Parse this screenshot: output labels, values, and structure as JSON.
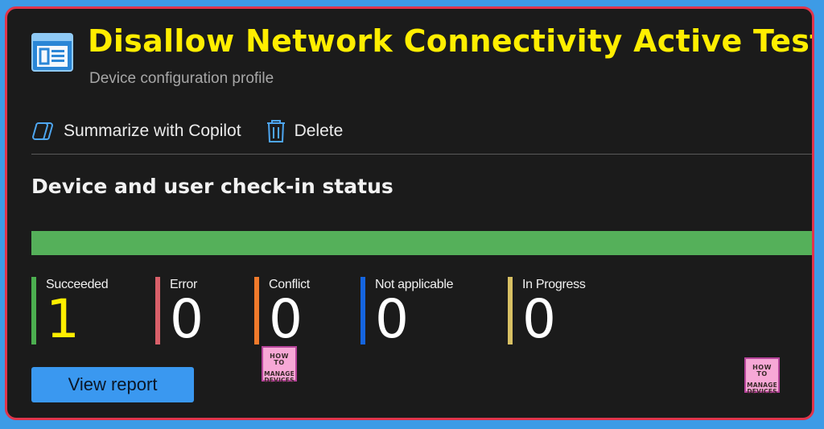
{
  "header": {
    "title": "Disallow Network Connectivity Active Tests",
    "subtitle": "Device configuration profile",
    "icon": "profile-icon"
  },
  "toolbar": {
    "summarize_label": "Summarize with Copilot",
    "delete_label": "Delete",
    "icons": [
      "copilot-icon",
      "trash-icon"
    ]
  },
  "status": {
    "title": "Device and user check-in status",
    "progress": {
      "succeeded_fraction": 1.0,
      "fill_color": "#55b05a"
    },
    "stats": [
      {
        "label": "Succeeded",
        "value": "1",
        "color": "#4caf50",
        "value_color": "#ffee00"
      },
      {
        "label": "Error",
        "value": "0",
        "color": "#d9606a",
        "value_color": "#ffffff"
      },
      {
        "label": "Conflict",
        "value": "0",
        "color": "#f07a2b",
        "value_color": "#ffffff"
      },
      {
        "label": "Not applicable",
        "value": "0",
        "color": "#1565e0",
        "value_color": "#ffffff"
      },
      {
        "label": "In Progress",
        "value": "0",
        "color": "#d8c063",
        "value_color": "#ffffff"
      }
    ]
  },
  "actions": {
    "view_report_label": "View report"
  },
  "watermark": {
    "top": "HOW TO",
    "bottom": "MANAGE DEVICES"
  },
  "colors": {
    "background": "#1b1b1b",
    "title": "#ffee00",
    "frame_border": "#e0354b",
    "outer": "#3d9be6",
    "accent": "#3a98f0"
  }
}
